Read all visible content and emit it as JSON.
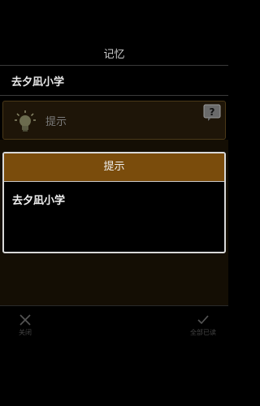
{
  "header": {
    "title": "记忆"
  },
  "item": {
    "title": "去夕凪小学"
  },
  "hint_row": {
    "label": "提示",
    "bulb_icon": "lightbulb-icon",
    "help_icon": "question-bubble-icon"
  },
  "dialog": {
    "title": "提示",
    "body": "去夕凪小学"
  },
  "toolbar": {
    "close_label": "关闭",
    "close_icon": "close-icon",
    "mark_all_label": "全部已读",
    "mark_all_icon": "check-icon"
  },
  "colors": {
    "background": "#000000",
    "dialog_header": "#7a4c0c",
    "card_border": "#4a3818"
  }
}
